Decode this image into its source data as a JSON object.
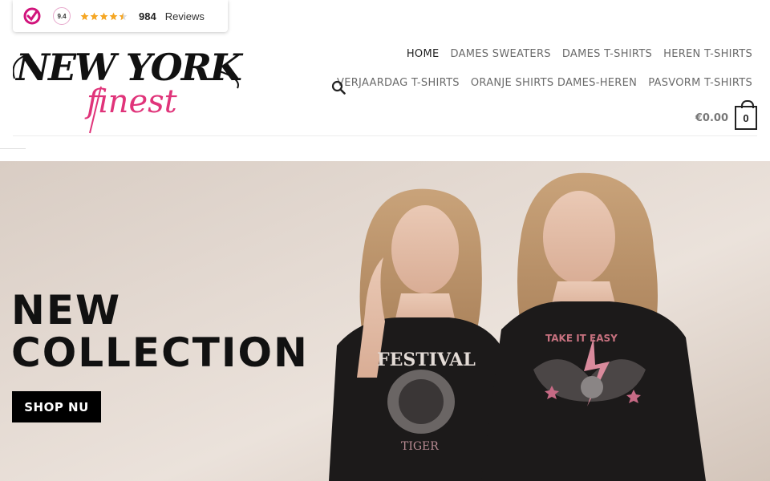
{
  "review_badge": {
    "score": "9.4",
    "count": "984",
    "label": "Reviews",
    "rating_stars": 4.5,
    "colors": {
      "brand": "#d1147c",
      "star": "#f5a623"
    }
  },
  "logo": {
    "line1": "NEW YORK",
    "line2": "finest",
    "colors": {
      "main": "#111111",
      "accent": "#e0347a"
    }
  },
  "nav": {
    "row1": [
      {
        "label": "HOME",
        "active": true
      },
      {
        "label": "DAMES SWEATERS"
      },
      {
        "label": "DAMES T-SHIRTS"
      },
      {
        "label": "HEREN T-SHIRTS"
      }
    ],
    "row2": [
      {
        "label": "VERJAARDAG T-SHIRTS"
      },
      {
        "label": "ORANJE SHIRTS DAMES-HEREN"
      },
      {
        "label": "PASVORM T-SHIRTS"
      }
    ],
    "search_icon": "search-icon"
  },
  "cart": {
    "total": "€0.00",
    "count": "0",
    "icon": "shopping-bag-icon"
  },
  "hero": {
    "title_line1": "NEW",
    "title_line2": "COLLECTION",
    "button_label": "SHOP NU",
    "shirt_left_text": "FESTIVAL",
    "shirt_left_sub": "TIGER",
    "shirt_right_text": "TAKE IT EASY"
  }
}
